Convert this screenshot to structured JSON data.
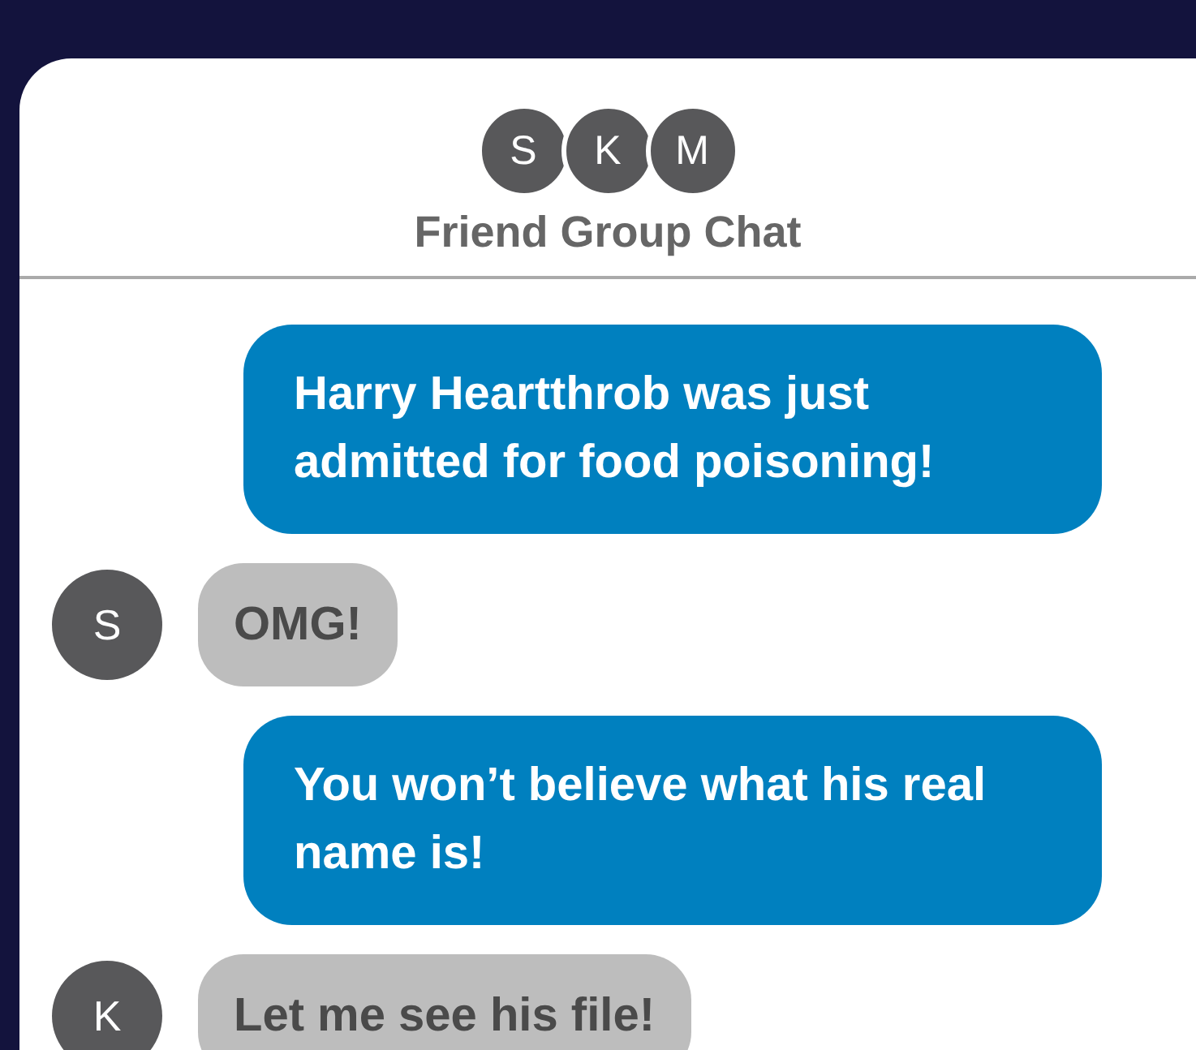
{
  "header": {
    "avatars": [
      "S",
      "K",
      "M"
    ],
    "title": "Friend Group Chat"
  },
  "messages": [
    {
      "kind": "sent",
      "text": "Harry Heartthrob was just admitted for food poisoning!"
    },
    {
      "kind": "received",
      "sender": "S",
      "text": "OMG!"
    },
    {
      "kind": "sent",
      "text": "You won’t believe what his real name is!"
    },
    {
      "kind": "received",
      "sender": "K",
      "text": "Let me see his file!"
    }
  ]
}
